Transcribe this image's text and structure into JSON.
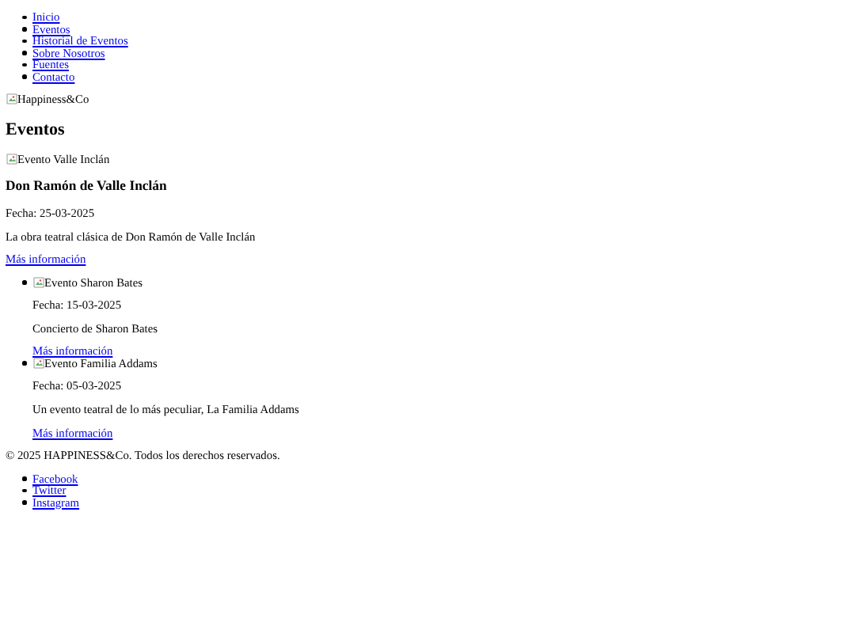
{
  "nav": [
    "Inicio",
    "Eventos",
    "Historial de Eventos",
    "Sobre Nosotros",
    "Fuentes",
    "Contacto"
  ],
  "logo": {
    "alt": "Happiness&Co"
  },
  "heading": "Eventos",
  "featured": {
    "image_alt": "Evento Valle Inclán",
    "title": "Don Ramón de Valle Inclán",
    "date": "Fecha: 25-03-2025",
    "description": "La obra teatral clásica de Don Ramón de Valle Inclán",
    "link": "Más información"
  },
  "events": [
    {
      "image_alt": "Evento Sharon Bates",
      "date": "Fecha: 15-03-2025",
      "description": "Concierto de Sharon Bates",
      "link": "Más información"
    },
    {
      "image_alt": "Evento Familia Addams",
      "date": "Fecha: 05-03-2025",
      "description": "Un evento teatral de lo más peculiar, La Familia Addams",
      "link": "Más información"
    }
  ],
  "footer": {
    "copyright": "© 2025 HAPPINESS&Co. Todos los derechos reservados.",
    "social": [
      "Facebook",
      "Twitter",
      "Instagram"
    ]
  }
}
